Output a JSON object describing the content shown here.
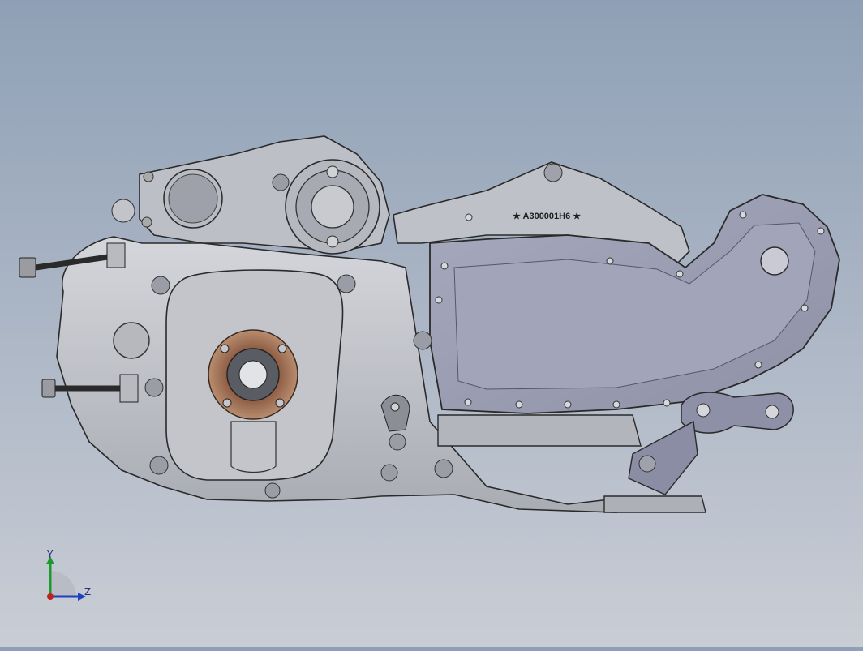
{
  "model": {
    "part_marking": "A300001H6",
    "marking_symbol": "★"
  },
  "triad": {
    "y_label": "Y",
    "z_label": "Z",
    "y_color": "#1a9a2a",
    "z_color": "#1f3fbf",
    "x_color": "#c02020"
  },
  "colors": {
    "background_top": "#8fa0b6",
    "background_bottom": "#c9cdd5",
    "casting": "#c4c6cc",
    "casting_dark": "#8d9098",
    "cover": "#9a9cb2",
    "seal": "#a8785a",
    "edge": "#2a2a2a"
  }
}
